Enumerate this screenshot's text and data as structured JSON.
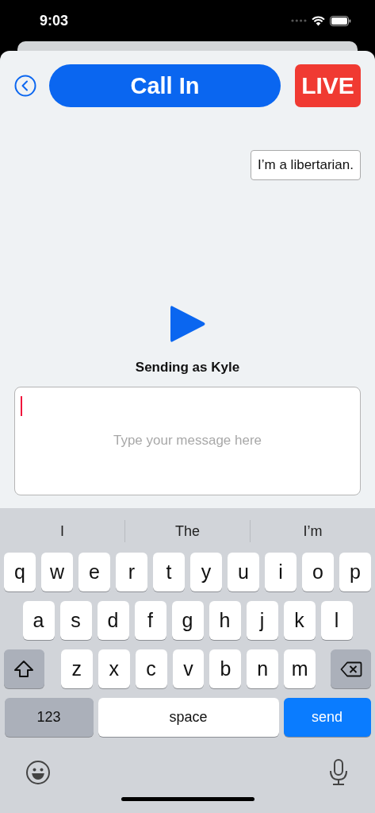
{
  "status_bar": {
    "time": "9:03"
  },
  "header": {
    "title": "Call In",
    "live_badge": "LIVE"
  },
  "messages": [
    {
      "text": "I’m a libertarian."
    }
  ],
  "sender_label": "Sending as Kyle",
  "composer": {
    "placeholder": "Type your message here"
  },
  "keyboard": {
    "suggestions": [
      "I",
      "The",
      "I’m"
    ],
    "rows": [
      [
        {
          "kind": "letter",
          "label": "q"
        },
        {
          "kind": "letter",
          "label": "w"
        },
        {
          "kind": "letter",
          "label": "e"
        },
        {
          "kind": "letter",
          "label": "r"
        },
        {
          "kind": "letter",
          "label": "t"
        },
        {
          "kind": "letter",
          "label": "y"
        },
        {
          "kind": "letter",
          "label": "u"
        },
        {
          "kind": "letter",
          "label": "i"
        },
        {
          "kind": "letter",
          "label": "o"
        },
        {
          "kind": "letter",
          "label": "p"
        }
      ],
      [
        {
          "kind": "letter",
          "label": "a"
        },
        {
          "kind": "letter",
          "label": "s"
        },
        {
          "kind": "letter",
          "label": "d"
        },
        {
          "kind": "letter",
          "label": "f"
        },
        {
          "kind": "letter",
          "label": "g"
        },
        {
          "kind": "letter",
          "label": "h"
        },
        {
          "kind": "letter",
          "label": "j"
        },
        {
          "kind": "letter",
          "label": "k"
        },
        {
          "kind": "letter",
          "label": "l"
        }
      ],
      [
        {
          "kind": "shift"
        },
        {
          "kind": "letter",
          "label": "z"
        },
        {
          "kind": "letter",
          "label": "x"
        },
        {
          "kind": "letter",
          "label": "c"
        },
        {
          "kind": "letter",
          "label": "v"
        },
        {
          "kind": "letter",
          "label": "b"
        },
        {
          "kind": "letter",
          "label": "n"
        },
        {
          "kind": "letter",
          "label": "m"
        },
        {
          "kind": "delete"
        }
      ]
    ],
    "bottom_keys": [
      {
        "kind": "mode",
        "label": "123"
      },
      {
        "kind": "space",
        "label": "space"
      },
      {
        "kind": "return",
        "label": "send"
      }
    ]
  }
}
